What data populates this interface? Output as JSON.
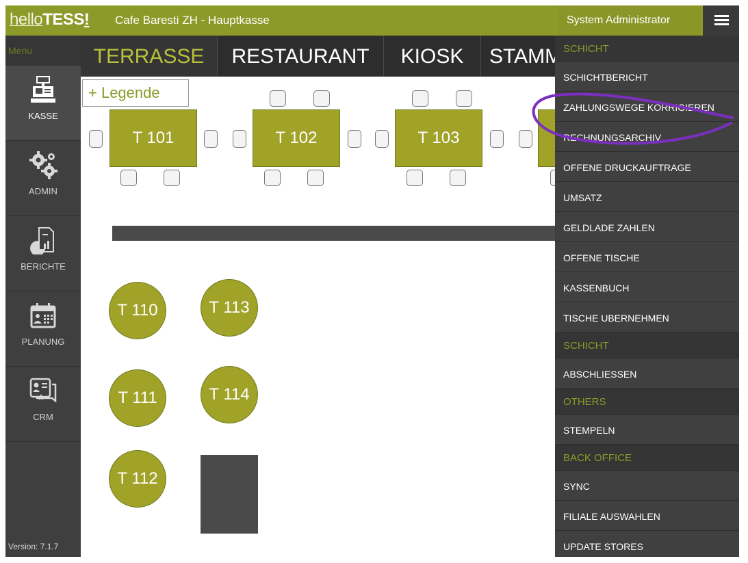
{
  "header": {
    "logo_light": "hello",
    "logo_bold": "TESS",
    "logo_excl": "!",
    "store_title": "Cafe Baresti ZH - Hauptkasse",
    "user_label": "System Administrator"
  },
  "sidebar": {
    "menu_label": "Menu",
    "items": [
      {
        "label": "KASSE",
        "icon": "cash-register-icon"
      },
      {
        "label": "ADMIN",
        "icon": "gears-icon"
      },
      {
        "label": "BERICHTE",
        "icon": "report-icon"
      },
      {
        "label": "PLANUNG",
        "icon": "calendar-icon"
      },
      {
        "label": "CRM",
        "icon": "contact-card-icon"
      }
    ],
    "version": "Version: 7.1.7"
  },
  "tabs": [
    "TERRASSE",
    "RESTAURANT",
    "KIOSK",
    "STAMM"
  ],
  "floor": {
    "legend_label": "+ Legende",
    "rect_tables": [
      "T 101",
      "T 102",
      "T 103"
    ],
    "round_tables": [
      "T 110",
      "T 113",
      "T 111",
      "T 114",
      "T 112"
    ]
  },
  "dropdown": {
    "sections": [
      {
        "title": "SCHICHT",
        "items": [
          "SCHICHTBERICHT",
          "ZAHLUNGSWEGE KORRIGIEREN",
          "RECHNUNGSARCHIV",
          "OFFENE DRUCKAUFTRAGE",
          "UMSATZ",
          "GELDLADE ZAHLEN",
          "OFFENE TISCHE",
          "KASSENBUCH",
          "TISCHE UBERNEHMEN"
        ]
      },
      {
        "title": "SCHICHT",
        "items": [
          "ABSCHLIESSEN"
        ]
      },
      {
        "title": "OTHERS",
        "items": [
          "STEMPELN"
        ]
      },
      {
        "title": "BACK OFFICE",
        "items": [
          "SYNC",
          "FILIALE AUSWAHLEN",
          "UPDATE STORES"
        ]
      }
    ]
  },
  "colors": {
    "brand": "#8c9a2a",
    "table_fill": "#a0a328",
    "annotation": "#7b2fbf"
  }
}
